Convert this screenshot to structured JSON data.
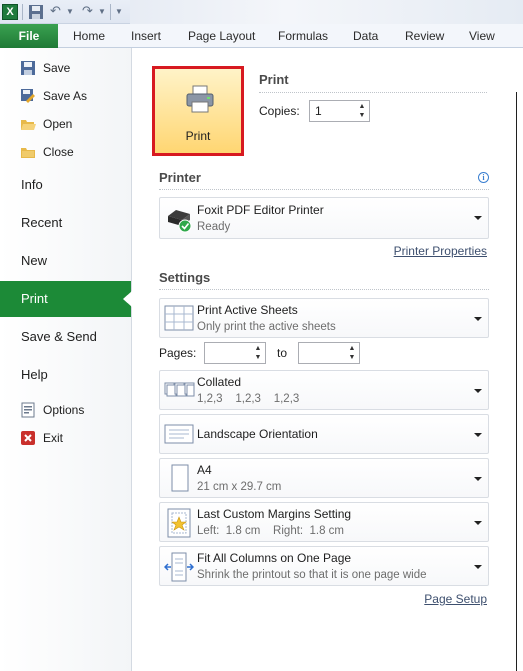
{
  "quick_access": {
    "app_icon": "excel-logo",
    "icons": [
      "save-icon",
      "undo-icon",
      "redo-icon",
      "customize-icon"
    ]
  },
  "ribbon": {
    "file_tab": "File",
    "tabs": [
      "Home",
      "Insert",
      "Page Layout",
      "Formulas",
      "Data",
      "Review",
      "View"
    ]
  },
  "nav": {
    "commands_top": [
      {
        "label": "Save",
        "icon": "save-icon"
      },
      {
        "label": "Save As",
        "icon": "save-as-icon"
      },
      {
        "label": "Open",
        "icon": "open-folder-icon"
      },
      {
        "label": "Close",
        "icon": "close-folder-icon"
      }
    ],
    "sections": [
      "Info",
      "Recent",
      "New",
      "Print",
      "Save & Send",
      "Help"
    ],
    "active": "Print",
    "commands_bottom": [
      {
        "label": "Options",
        "icon": "options-icon"
      },
      {
        "label": "Exit",
        "icon": "exit-icon"
      }
    ]
  },
  "print": {
    "button_label": "Print",
    "heading": "Print",
    "copies_label": "Copies:",
    "copies_value": "1"
  },
  "printer": {
    "heading": "Printer",
    "name": "Foxit PDF Editor Printer",
    "status": "Ready",
    "properties_link": "Printer Properties"
  },
  "settings": {
    "heading": "Settings",
    "scope": {
      "title": "Print Active Sheets",
      "subtitle": "Only print the active sheets"
    },
    "pages_label": "Pages:",
    "pages_from": "",
    "to_label": "to",
    "pages_to": "",
    "collation": {
      "title": "Collated",
      "subtitle": "1,2,3    1,2,3    1,2,3"
    },
    "orientation": {
      "title": "Landscape Orientation"
    },
    "paper": {
      "title": "A4",
      "subtitle": "21 cm x 29.7 cm"
    },
    "margins": {
      "title": "Last Custom Margins Setting",
      "subtitle": "Left:  1.8 cm    Right:  1.8 cm"
    },
    "scaling": {
      "title": "Fit All Columns on One Page",
      "subtitle": "Shrink the printout so that it is one page wide"
    },
    "page_setup_link": "Page Setup"
  },
  "colors": {
    "accent_green": "#1c8a37",
    "highlight_border": "#d71920",
    "button_gold": "#ffd672"
  }
}
